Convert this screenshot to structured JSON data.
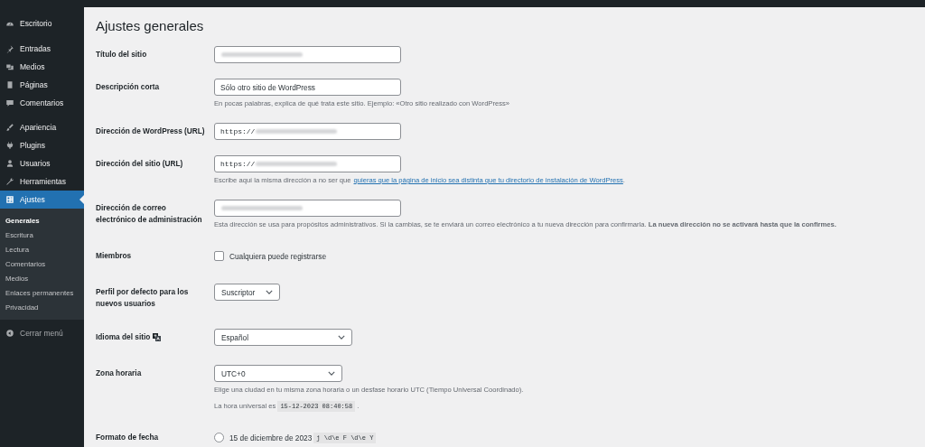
{
  "sidebar": {
    "items": [
      {
        "label": "Escritorio",
        "selected": false
      },
      {
        "label": "Entradas",
        "selected": false
      },
      {
        "label": "Medios",
        "selected": false
      },
      {
        "label": "Páginas",
        "selected": false
      },
      {
        "label": "Comentarios",
        "selected": false
      },
      {
        "label": "Apariencia",
        "selected": false
      },
      {
        "label": "Plugins",
        "selected": false
      },
      {
        "label": "Usuarios",
        "selected": false
      },
      {
        "label": "Herramientas",
        "selected": false
      },
      {
        "label": "Ajustes",
        "selected": true,
        "children": [
          {
            "label": "Generales",
            "selected": true
          },
          {
            "label": "Escritura",
            "selected": false
          },
          {
            "label": "Lectura",
            "selected": false
          },
          {
            "label": "Comentarios",
            "selected": false
          },
          {
            "label": "Medios",
            "selected": false
          },
          {
            "label": "Enlaces permanentes",
            "selected": false
          },
          {
            "label": "Privacidad",
            "selected": false
          }
        ]
      }
    ],
    "collapse": "Cerrar menú"
  },
  "page_title": "Ajustes generales",
  "rows": [
    {
      "kind": "text",
      "label": "Título del sitio",
      "blurred": true
    },
    {
      "kind": "text",
      "label": "Descripción corta",
      "value": "Sólo otro sitio de WordPress",
      "hint": "En pocas palabras, explica de qué trata este sitio. Ejemplo: «Otro sitio realizado con WordPress»"
    },
    {
      "kind": "url",
      "label": "Dirección de WordPress (URL)",
      "value": "https://",
      "blurred": true
    },
    {
      "kind": "url",
      "label": "Dirección del sitio (URL)",
      "value": "https://",
      "blurred": true,
      "hint": "Escribe aquí la misma dirección a no ser que",
      "hint_link": "quieras que la página de inicio sea distinta que tu directorio de instalación de WordPress",
      "hint_end": "."
    },
    {
      "kind": "text",
      "label": "Dirección de correo electrónico de administración",
      "blurred": true,
      "hint": "Esta dirección se usa para propósitos administrativos. Si la cambias, se te enviará un correo electrónico a tu nueva dirección para confirmarla. **La nueva dirección no se activará hasta que la confirmes.**"
    },
    {
      "kind": "checkbox",
      "label": "Miembros",
      "option": "Cualquiera puede registrarse",
      "checked": false
    },
    {
      "kind": "select",
      "label": "Perfil por defecto para los nuevos usuarios",
      "value": "Suscriptor"
    },
    {
      "kind": "select",
      "label": "Idioma del sitio",
      "label_icon": true,
      "value": "Español"
    },
    {
      "kind": "select",
      "label": "Zona horaria",
      "value": "UTC+0",
      "hint": "Elige una ciudad en tu misma zona horaria o un desfase horario UTC (Tiempo Universal Coordinado).",
      "time_label": "La hora universal es",
      "time_value": "15-12-2023 08:40:58",
      "time_end": "."
    },
    {
      "kind": "radio",
      "label": "Formato de fecha",
      "option": "15 de diciembre de 2023",
      "code": "j \\d\\e F \\d\\e Y",
      "selected": false
    }
  ]
}
